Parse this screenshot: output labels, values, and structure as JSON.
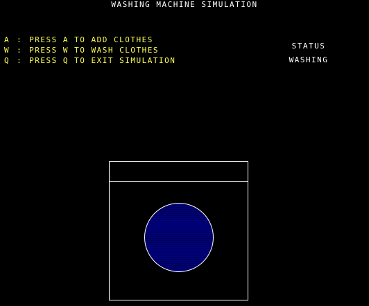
{
  "title": "WASHING MACHINE SIMULATION",
  "menu": [
    {
      "key": "A",
      "separator": ":",
      "text": "PRESS A TO ADD CLOTHES"
    },
    {
      "key": "W",
      "separator": ":",
      "text": "PRESS W TO WASH CLOTHES"
    },
    {
      "key": "Q",
      "separator": ":",
      "text": "PRESS Q TO EXIT SIMULATION"
    }
  ],
  "status": {
    "label": "STATUS",
    "value": "WASHING"
  },
  "colors": {
    "background": "#000000",
    "title_text": "#ffffff",
    "menu_text": "#ffff55",
    "status_text": "#ffffff",
    "machine_outline": "#ffffff",
    "drum_fill": "#000080"
  }
}
